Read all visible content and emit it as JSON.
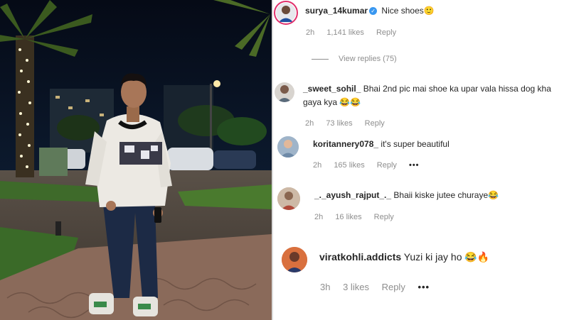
{
  "comments": [
    {
      "username": "surya_14kumar",
      "text": "Nice shoes",
      "emoji": "🙂",
      "time": "2h",
      "likes": "1,141 likes",
      "reply": "Reply",
      "verified": true
    },
    {
      "username": "_sweet_sohil_",
      "text": "Bhai 2nd pic mai shoe ka upar vala hissa dog kha",
      "text2": "gaya kya",
      "emoji": "😂😂",
      "time": "2h",
      "likes": "73 likes",
      "reply": "Reply"
    },
    {
      "username": "koritannery078_",
      "text": "it's super beautiful",
      "time": "2h",
      "likes": "165 likes",
      "reply": "Reply",
      "more": "•••"
    },
    {
      "username": "_._ayush_rajput_._",
      "text": "Bhaii kiske jutee churaye",
      "emoji": "😂",
      "time": "2h",
      "likes": "16 likes",
      "reply": "Reply"
    },
    {
      "username": "viratkohli.addicts",
      "text": "Yuzi ki jay ho",
      "emoji": "😂🔥",
      "time": "3h",
      "likes": "3 likes",
      "reply": "Reply",
      "more": "•••"
    }
  ],
  "view_replies": "View replies (75)",
  "icons": {
    "verified": "verified-badge-icon",
    "more": "more-options-icon"
  }
}
